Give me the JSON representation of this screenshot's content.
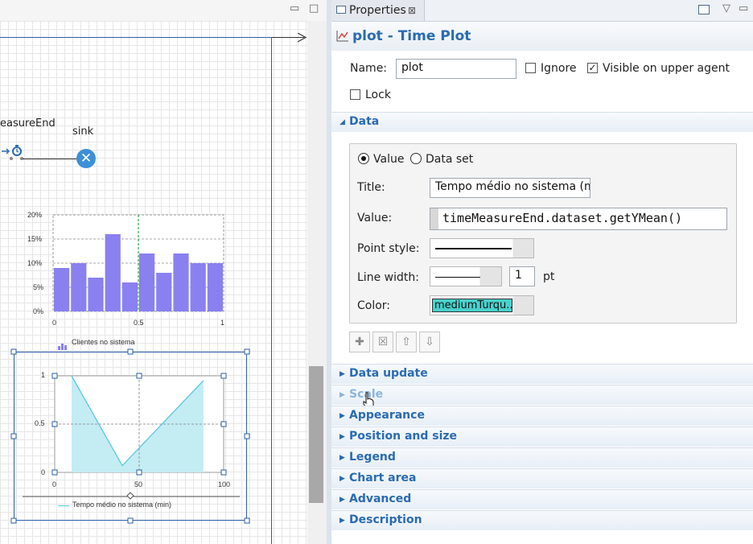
{
  "editor": {
    "measure_label": "easureEnd",
    "sink_label": "sink",
    "hist": {
      "legend": "Clientes no sistema",
      "yticks": [
        "20%",
        "15%",
        "10%",
        "5%",
        "0%"
      ],
      "xticks": [
        "0",
        "0.5",
        "1"
      ],
      "values": [
        9,
        10,
        7,
        16,
        6,
        12,
        8,
        12,
        10,
        10
      ],
      "color": "#8a80f0"
    },
    "timeplot": {
      "legend": "Tempo médio no sistema (min)",
      "yticks": [
        "1",
        "0.5",
        "0"
      ],
      "xticks": [
        "0",
        "50",
        "100"
      ],
      "x": [
        10,
        40,
        88
      ],
      "y": [
        1,
        0.07,
        0.95
      ],
      "color": "#5bc8dc"
    }
  },
  "props": {
    "tab_label": "Properties",
    "tab_close": "⊠",
    "title": "plot - Time Plot",
    "name_label": "Name:",
    "name_value": "plot",
    "ignore_label": "Ignore",
    "visible_label": "Visible on upper agent",
    "lock_label": "Lock",
    "data_section": "Data",
    "radio_value": "Value",
    "radio_dataset": "Data set",
    "title_label": "Title:",
    "title_value": "Tempo médio no sistema (m",
    "value_label": "Value:",
    "value_value": "timeMeasureEnd.dataset.getYMean()",
    "point_style_label": "Point style:",
    "line_width_label": "Line width:",
    "line_width_value": "1",
    "line_width_unit": "pt",
    "color_label": "Color:",
    "color_value": "mediumTurqu...",
    "color_hex": "#48d1cc",
    "sections": [
      "Data update",
      "Scale",
      "Appearance",
      "Position and size",
      "Legend",
      "Chart area",
      "Advanced",
      "Description"
    ]
  }
}
